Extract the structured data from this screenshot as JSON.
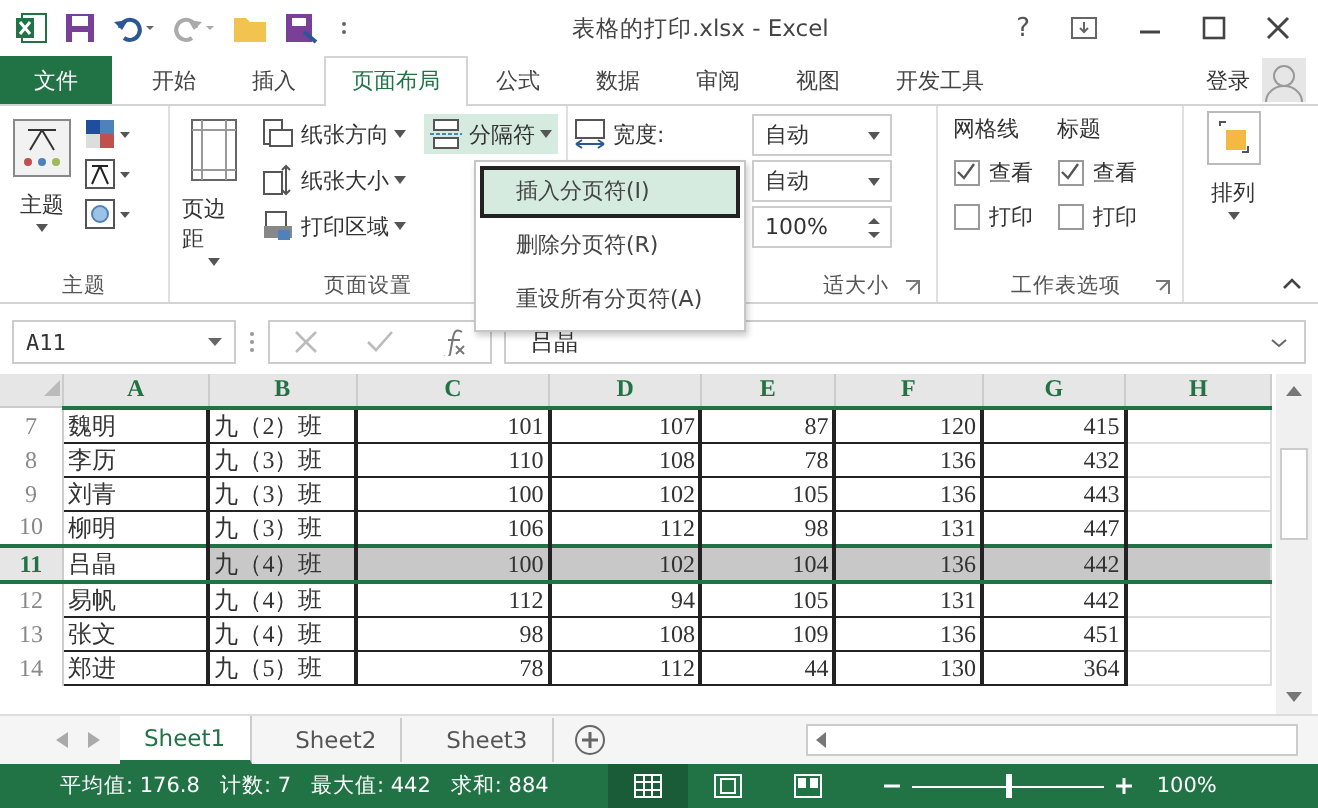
{
  "window": {
    "title": "表格的打印.xlsx - Excel",
    "help": "?"
  },
  "tabs": [
    {
      "label": "文件",
      "kind": "file",
      "selected": false
    },
    {
      "label": "开始",
      "kind": "tab",
      "selected": false
    },
    {
      "label": "插入",
      "kind": "tab",
      "selected": false
    },
    {
      "label": "页面布局",
      "kind": "tab",
      "selected": true
    },
    {
      "label": "公式",
      "kind": "tab",
      "selected": false
    },
    {
      "label": "数据",
      "kind": "tab",
      "selected": false
    },
    {
      "label": "审阅",
      "kind": "tab",
      "selected": false
    },
    {
      "label": "视图",
      "kind": "tab",
      "selected": false
    },
    {
      "label": "开发工具",
      "kind": "tab",
      "selected": false
    }
  ],
  "user": "登录",
  "ribbon": {
    "themes": {
      "button": "主题",
      "label": "主题"
    },
    "page_setup": {
      "margins": "页边距",
      "items": [
        "纸张方向",
        "纸张大小",
        "打印区域"
      ],
      "breaks": {
        "label": "分隔符",
        "expanded": true
      },
      "label": "页面设置"
    },
    "scale": {
      "width_label": "宽度:",
      "width": "自动",
      "height": "自动",
      "zoom": "100%",
      "label": "适大小"
    },
    "sheet_options": {
      "label": "工作表选项",
      "columns": [
        {
          "title": "网格线",
          "options": [
            {
              "label": "查看",
              "checked": true
            },
            {
              "label": "打印",
              "checked": false
            }
          ]
        },
        {
          "title": "标题",
          "options": [
            {
              "label": "查看",
              "checked": true
            },
            {
              "label": "打印",
              "checked": false
            }
          ]
        }
      ]
    },
    "arrange": {
      "label": "排列"
    }
  },
  "breaks_menu": [
    {
      "label": "插入分页符(I)",
      "selected": true
    },
    {
      "label": "删除分页符(R)",
      "selected": false
    },
    {
      "label": "重设所有分页符(A)",
      "selected": false
    }
  ],
  "name_box": "A11",
  "formula": "吕晶",
  "sheet": {
    "columns": [
      "A",
      "B",
      "C",
      "D",
      "E",
      "F",
      "G",
      "H"
    ],
    "rows": [
      {
        "header": "7",
        "cells": [
          "魏明",
          "九（2）班",
          "101",
          "107",
          "87",
          "120",
          "415"
        ],
        "selected": false
      },
      {
        "header": "8",
        "cells": [
          "李历",
          "九（3）班",
          "110",
          "108",
          "78",
          "136",
          "432"
        ],
        "selected": false
      },
      {
        "header": "9",
        "cells": [
          "刘青",
          "九（3）班",
          "100",
          "102",
          "105",
          "136",
          "443"
        ],
        "selected": false
      },
      {
        "header": "10",
        "cells": [
          "柳明",
          "九（3）班",
          "106",
          "112",
          "98",
          "131",
          "447"
        ],
        "selected": false
      },
      {
        "header": "11",
        "cells": [
          "吕晶",
          "九（4）班",
          "100",
          "102",
          "104",
          "136",
          "442"
        ],
        "selected": true
      },
      {
        "header": "12",
        "cells": [
          "易帆",
          "九（4）班",
          "112",
          "94",
          "105",
          "131",
          "442"
        ],
        "selected": false
      },
      {
        "header": "13",
        "cells": [
          "张文",
          "九（4）班",
          "98",
          "108",
          "109",
          "136",
          "451"
        ],
        "selected": false
      },
      {
        "header": "14",
        "cells": [
          "郑进",
          "九（5）班",
          "78",
          "112",
          "44",
          "130",
          "364"
        ],
        "selected": false
      }
    ]
  },
  "sheet_tabs": [
    {
      "label": "Sheet1",
      "selected": true
    },
    {
      "label": "Sheet2",
      "selected": false
    },
    {
      "label": "Sheet3",
      "selected": false
    }
  ],
  "status_bar": {
    "stats": [
      "平均值: 176.8",
      "计数: 7",
      "最大值: 442",
      "求和: 884"
    ],
    "zoom": {
      "level": 0.5,
      "reading": "100%"
    }
  }
}
